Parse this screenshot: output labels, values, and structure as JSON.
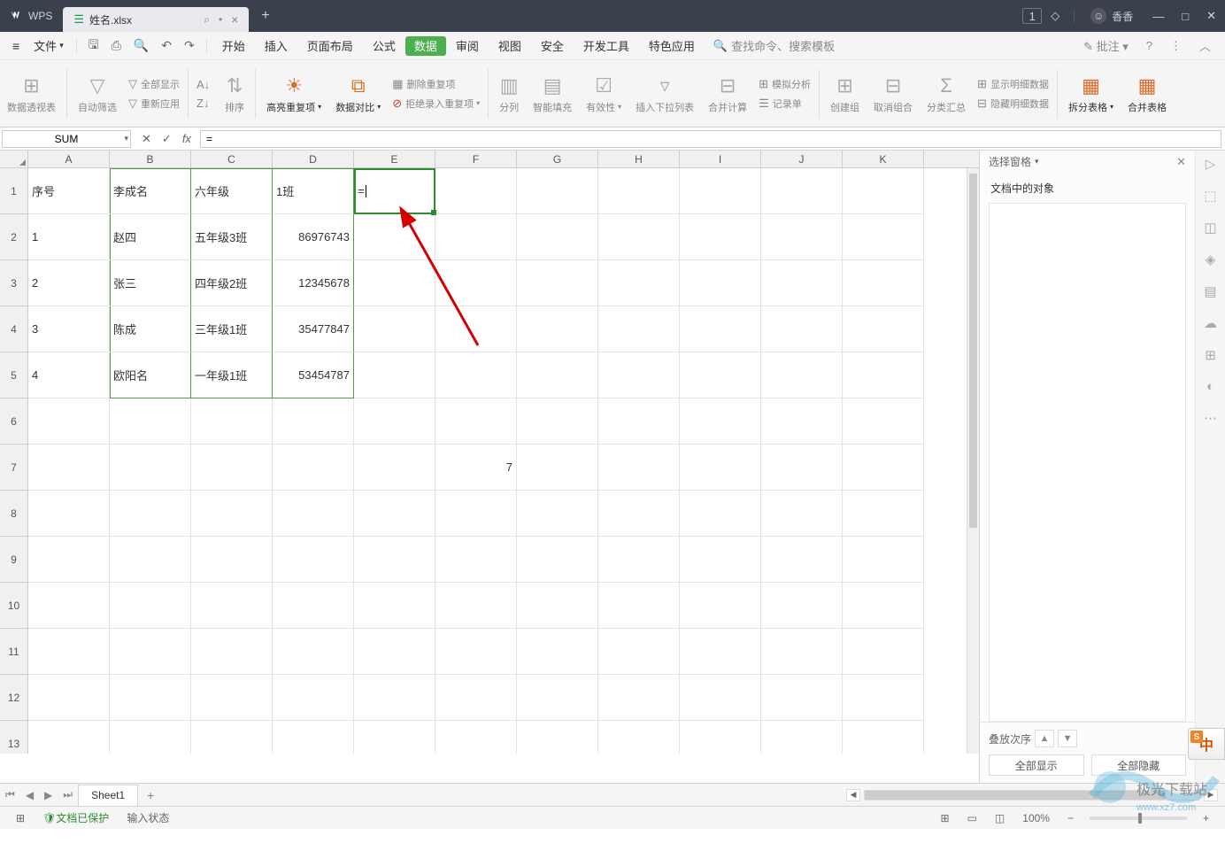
{
  "titlebar": {
    "app": "WPS",
    "tab_name": "姓名.xlsx",
    "badge": "1",
    "user_name": "香香"
  },
  "menubar": {
    "file": "文件",
    "tabs": [
      "开始",
      "插入",
      "页面布局",
      "公式",
      "数据",
      "审阅",
      "视图",
      "安全",
      "开发工具",
      "特色应用"
    ],
    "active_tab_index": 4,
    "search_placeholder": "查找命令、搜索模板",
    "annotate": "批注"
  },
  "ribbon": {
    "pivot": "数据透视表",
    "autofilter": "自动筛选",
    "show_all": "全部显示",
    "reapply": "重新应用",
    "sort_icon": "A↓Z",
    "sort": "排序",
    "highlight_dup": "高亮重复项",
    "data_compare": "数据对比",
    "remove_dup": "删除重复项",
    "reject_dup": "拒绝录入重复项",
    "split_col": "分列",
    "smart_fill": "智能填充",
    "validation": "有效性",
    "insert_dropdown": "插入下拉列表",
    "consolidate": "合并计算",
    "what_if": "模拟分析",
    "record_form": "记录单",
    "group": "创建组",
    "ungroup": "取消组合",
    "subtotal": "分类汇总",
    "show_detail": "显示明细数据",
    "hide_detail": "隐藏明细数据",
    "split_table": "拆分表格",
    "merge_table": "合并表格"
  },
  "formulabar": {
    "namebox": "SUM",
    "formula": "="
  },
  "columns": [
    "A",
    "B",
    "C",
    "D",
    "E",
    "F",
    "G",
    "H",
    "I",
    "J",
    "K"
  ],
  "table": {
    "rows": [
      {
        "n": "1",
        "a": "序号",
        "b": "李成名",
        "c": "六年级",
        "d": "1班",
        "e": "="
      },
      {
        "n": "2",
        "a": "1",
        "b": "赵四",
        "c": "五年级3班",
        "d": "86976743"
      },
      {
        "n": "3",
        "a": "2",
        "b": "张三",
        "c": "四年级2班",
        "d": "12345678"
      },
      {
        "n": "4",
        "a": "3",
        "b": "陈成",
        "c": "三年级1班",
        "d": "35477847"
      },
      {
        "n": "5",
        "a": "4",
        "b": "欧阳名",
        "c": "一年级1班",
        "d": "53454787"
      }
    ],
    "stray": {
      "row": 7,
      "col": "F",
      "val": "7"
    }
  },
  "sidepanel": {
    "selector": "选择窗格",
    "title": "文档中的对象",
    "stack_order": "叠放次序",
    "show_all": "全部显示",
    "hide_all": "全部隐藏"
  },
  "sheettabs": {
    "active": "Sheet1"
  },
  "statusbar": {
    "protected": "文档已保护",
    "input_mode": "输入状态",
    "zoom": "100%"
  },
  "watermark": {
    "text": "极光下载站",
    "url": "www.xz7.com"
  },
  "ime": "中"
}
